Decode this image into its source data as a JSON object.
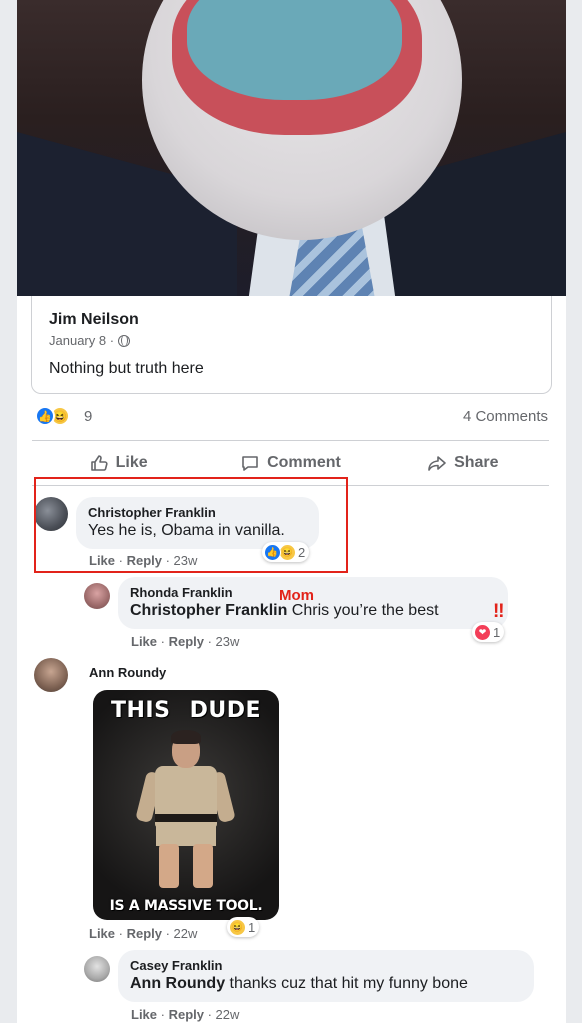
{
  "shared_post": {
    "author": "Jim Neilson",
    "date": "January 8 ·",
    "text": "Nothing but truth here"
  },
  "post_stats": {
    "reaction_count": "9",
    "comments_count": "4 Comments"
  },
  "actions": {
    "like": "Like",
    "comment": "Comment",
    "share": "Share"
  },
  "comments": [
    {
      "name": "Christopher Franklin",
      "text": "Yes he is, Obama in vanilla.",
      "like": "Like",
      "reply": "Reply",
      "time": "23w",
      "reaction_count": "2"
    },
    {
      "name": "Rhonda Franklin",
      "mention": "Christopher Franklin",
      "text": " Chris you’re the best",
      "like": "Like",
      "reply": "Reply",
      "time": "23w",
      "reaction_count": "1"
    },
    {
      "name": "Ann Roundy",
      "like": "Like",
      "reply": "Reply",
      "time": "22w",
      "reaction_count": "1",
      "meme": {
        "top_left": "THIS",
        "top_right": "DUDE",
        "bottom": "IS A MASSIVE TOOL."
      }
    },
    {
      "name": "Casey Franklin",
      "mention": "Ann Roundy",
      "text": " thanks cuz that hit my funny bone",
      "like": "Like",
      "reply": "Reply",
      "time": "22w"
    }
  ],
  "annotations": {
    "mom_label": "Mom",
    "exclamation": "‼"
  },
  "colors": {
    "highlight": "#e2231a",
    "like_blue": "#1877f2",
    "haha_yellow": "#f7c744",
    "love_red": "#f33e58"
  },
  "icons": [
    "like-icon",
    "haha-icon",
    "love-icon",
    "globe-icon",
    "thumbs-up-icon",
    "comment-icon",
    "share-icon"
  ]
}
